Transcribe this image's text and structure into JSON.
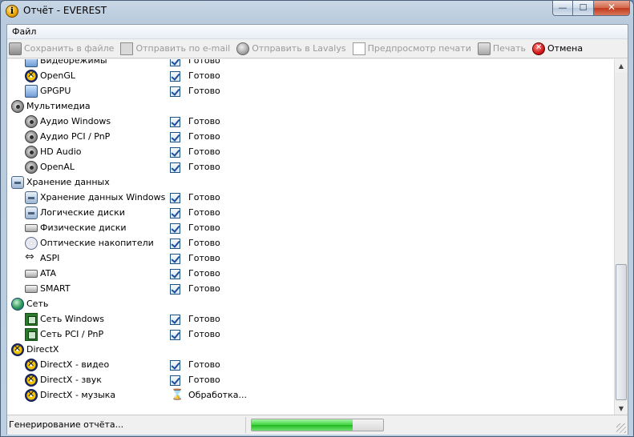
{
  "window": {
    "title": "Отчёт - EVEREST",
    "app_icon_glyph": "i"
  },
  "caption": {
    "minimize": "—",
    "maximize": "☐",
    "close": "✕"
  },
  "menu": {
    "file": "Файл"
  },
  "toolbar": {
    "save": {
      "label": "Сохранить в файле",
      "icon": "floppy-icon",
      "enabled": false
    },
    "email": {
      "label": "Отправить по e-mail",
      "icon": "mail-icon",
      "enabled": false
    },
    "lavalys": {
      "label": "Отправить в Lavalys",
      "icon": "globe-icon",
      "enabled": false
    },
    "preview": {
      "label": "Предпросмотр печати",
      "icon": "page-icon",
      "enabled": false
    },
    "print": {
      "label": "Печать",
      "icon": "printer-icon",
      "enabled": false
    },
    "cancel": {
      "label": "Отмена",
      "icon": "cancel-icon",
      "enabled": true
    }
  },
  "list": {
    "rows": [
      {
        "type": "item",
        "label": "Видеорежимы",
        "icon": "monitor",
        "status": "Готово",
        "state": "done"
      },
      {
        "type": "item",
        "label": "OpenGL",
        "icon": "directx",
        "status": "Готово",
        "state": "done"
      },
      {
        "type": "item",
        "label": "GPGPU",
        "icon": "monitor",
        "status": "Готово",
        "state": "done"
      },
      {
        "type": "cat",
        "label": "Мультимедиа",
        "icon": "speaker"
      },
      {
        "type": "item",
        "label": "Аудио Windows",
        "icon": "speaker",
        "status": "Готово",
        "state": "done"
      },
      {
        "type": "item",
        "label": "Аудио PCI / PnP",
        "icon": "speaker",
        "status": "Готово",
        "state": "done"
      },
      {
        "type": "item",
        "label": "HD Audio",
        "icon": "speaker",
        "status": "Готово",
        "state": "done"
      },
      {
        "type": "item",
        "label": "OpenAL",
        "icon": "speaker",
        "status": "Готово",
        "state": "done"
      },
      {
        "type": "cat",
        "label": "Хранение данных",
        "icon": "storage"
      },
      {
        "type": "item",
        "label": "Хранение данных Windows",
        "icon": "storage",
        "status": "Готово",
        "state": "done"
      },
      {
        "type": "item",
        "label": "Логические диски",
        "icon": "storage",
        "status": "Готово",
        "state": "done"
      },
      {
        "type": "item",
        "label": "Физические диски",
        "icon": "disk",
        "status": "Готово",
        "state": "done"
      },
      {
        "type": "item",
        "label": "Оптические накопители",
        "icon": "cd",
        "status": "Готово",
        "state": "done"
      },
      {
        "type": "item",
        "label": "ASPI",
        "icon": "aspi",
        "status": "Готово",
        "state": "done"
      },
      {
        "type": "item",
        "label": "ATA",
        "icon": "disk",
        "status": "Готово",
        "state": "done"
      },
      {
        "type": "item",
        "label": "SMART",
        "icon": "disk",
        "status": "Готово",
        "state": "done"
      },
      {
        "type": "cat",
        "label": "Сеть",
        "icon": "globe"
      },
      {
        "type": "item",
        "label": "Сеть Windows",
        "icon": "board",
        "status": "Готово",
        "state": "done"
      },
      {
        "type": "item",
        "label": "Сеть PCI / PnP",
        "icon": "board",
        "status": "Готово",
        "state": "done"
      },
      {
        "type": "cat",
        "label": "DirectX",
        "icon": "directx"
      },
      {
        "type": "item",
        "label": "DirectX - видео",
        "icon": "directx",
        "status": "Готово",
        "state": "done"
      },
      {
        "type": "item",
        "label": "DirectX - звук",
        "icon": "directx",
        "status": "Готово",
        "state": "done"
      },
      {
        "type": "item",
        "label": "DirectX - музыка",
        "icon": "directx",
        "status": "Обработка...",
        "state": "processing"
      }
    ]
  },
  "statusbar": {
    "text": "Генерирование отчёта...",
    "progress": 0.77
  },
  "colors": {
    "progress_fill": "#3dd43d",
    "cancel": "#d11a1a",
    "check": "#1e4e99"
  }
}
